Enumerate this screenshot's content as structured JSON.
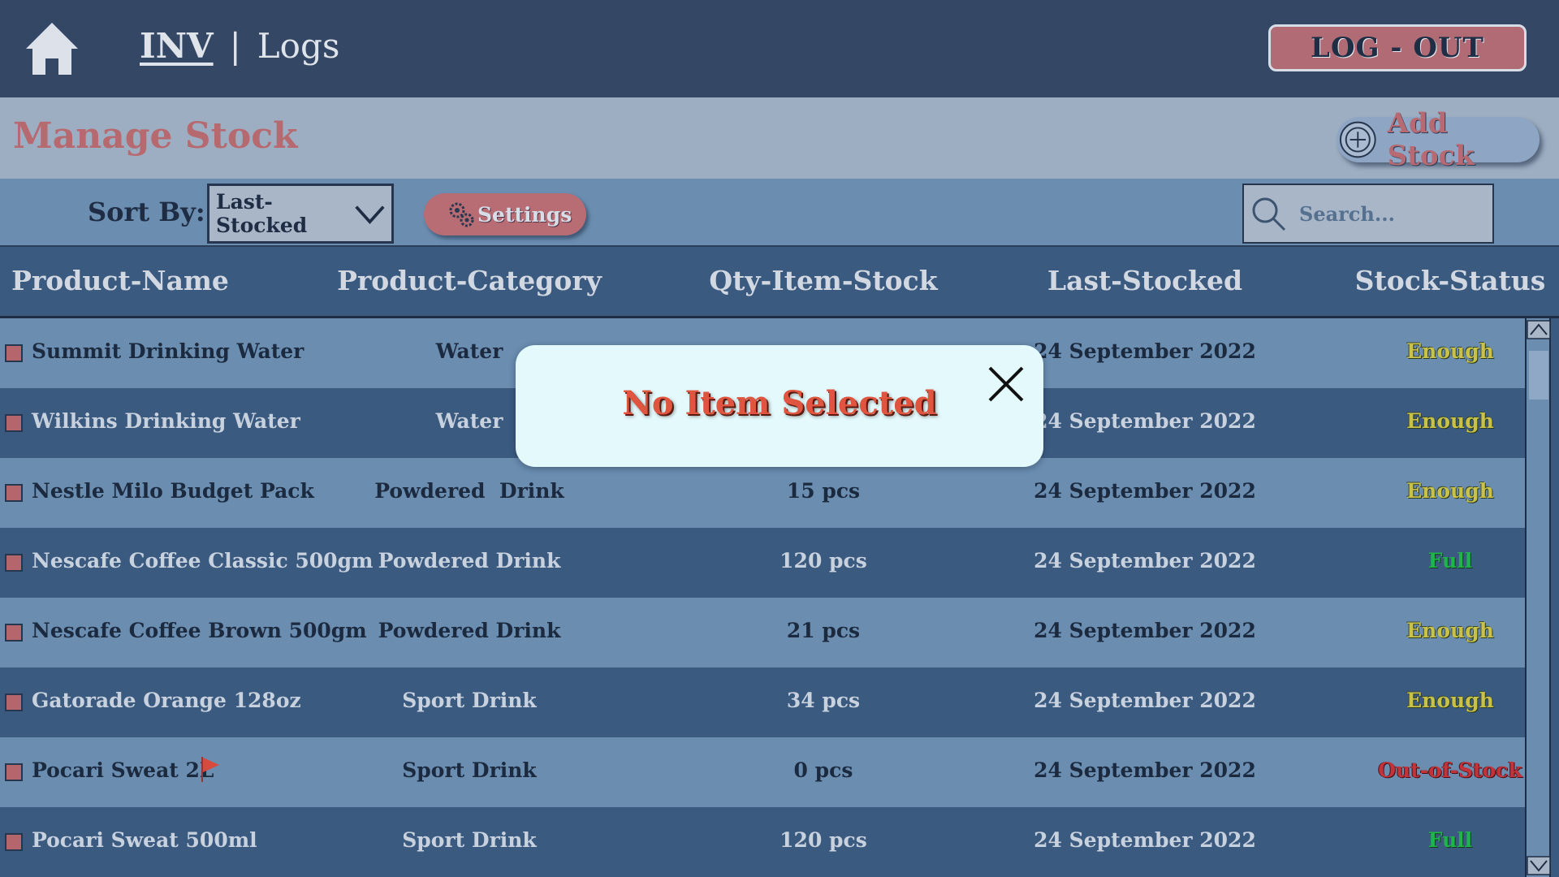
{
  "header": {
    "nav_inv": "INV",
    "nav_separator": "|",
    "nav_logs": "Logs",
    "logout_label": "LOG - OUT"
  },
  "titlebar": {
    "title": "Manage Stock",
    "add_stock_label": "Add Stock"
  },
  "filters": {
    "sort_label": "Sort By:",
    "sort_value": "Last-Stocked",
    "settings_label": "Settings",
    "search_placeholder": "Search..."
  },
  "table": {
    "columns": [
      "Product-Name",
      "Product-Category",
      "Qty-Item-Stock",
      "Last-Stocked",
      "Stock-Status"
    ],
    "rows": [
      {
        "name": "Summit Drinking Water",
        "category": "Water",
        "qty": "",
        "last": "24 September 2022",
        "status": "Enough",
        "status_type": "enough",
        "flag": false
      },
      {
        "name": "Wilkins Drinking Water",
        "category": "Water",
        "qty": "",
        "last": "24 September 2022",
        "status": "Enough",
        "status_type": "enough",
        "flag": false
      },
      {
        "name": "Nestle Milo Budget Pack",
        "category": "Powdered  Drink",
        "qty": "15 pcs",
        "last": "24 September 2022",
        "status": "Enough",
        "status_type": "enough",
        "flag": false
      },
      {
        "name": "Nescafe Coffee Classic 500gm",
        "category": "Powdered Drink",
        "qty": "120 pcs",
        "last": "24 September 2022",
        "status": "Full",
        "status_type": "full",
        "flag": false
      },
      {
        "name": "Nescafe Coffee Brown 500gm",
        "category": "Powdered Drink",
        "qty": "21 pcs",
        "last": "24 September 2022",
        "status": "Enough",
        "status_type": "enough",
        "flag": false
      },
      {
        "name": "Gatorade Orange 128oz",
        "category": "Sport Drink",
        "qty": "34 pcs",
        "last": "24 September 2022",
        "status": "Enough",
        "status_type": "enough",
        "flag": false
      },
      {
        "name": "Pocari Sweat 2L",
        "category": "Sport Drink",
        "qty": "0 pcs",
        "last": "24 September 2022",
        "status": "Out-of-Stock",
        "status_type": "out",
        "flag": true
      },
      {
        "name": "Pocari Sweat 500ml",
        "category": "Sport Drink",
        "qty": "120 pcs",
        "last": "24 September 2022",
        "status": "Full",
        "status_type": "full",
        "flag": false
      }
    ]
  },
  "modal": {
    "message": "No Item Selected"
  },
  "colors": {
    "topbar": "#344866",
    "accent_red": "#b66a6f",
    "row_light": "#6a8db0",
    "row_dark": "#3b5a80",
    "status_enough": "#c9c24a",
    "status_full": "#1fb54a",
    "status_out": "#c2333a"
  },
  "icons": {
    "home": "home-icon",
    "add": "plus-circle-icon",
    "settings": "gears-icon",
    "search": "search-icon",
    "sort": "chevron-down-icon",
    "close": "close-icon",
    "flag": "flag-icon"
  }
}
